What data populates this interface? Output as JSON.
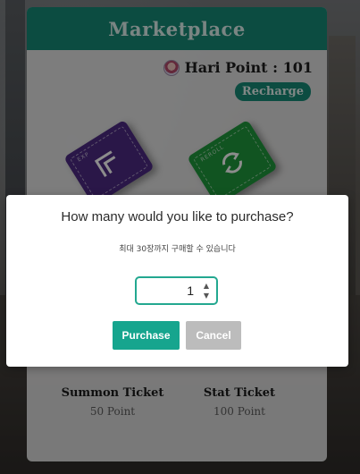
{
  "marketplace": {
    "title": "Marketplace",
    "points_label": "Hari Point : 101",
    "recharge_label": "Recharge",
    "items": [
      {
        "name": "Summon Ticket",
        "price": "50 Point",
        "tag": "EXP",
        "color": "#4d2a83"
      },
      {
        "name": "Stat Ticket",
        "price": "100 Point",
        "tag": "REROLL",
        "color": "#1f9a3c"
      }
    ]
  },
  "dialog": {
    "title": "How many would you like to purchase?",
    "subtitle": "최대 30장까지 구매할 수 있습니다",
    "quantity": "1",
    "purchase_label": "Purchase",
    "cancel_label": "Cancel"
  },
  "colors": {
    "accent": "#16a58e",
    "header": "#178a77",
    "cancel": "#bcbcbc"
  }
}
